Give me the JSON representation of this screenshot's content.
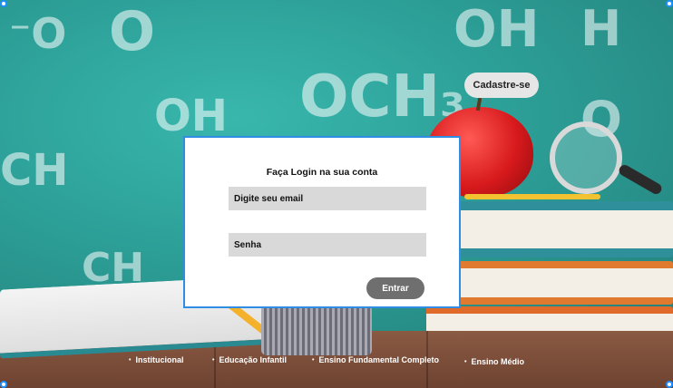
{
  "header": {
    "register_button": "Cadastre-se"
  },
  "login": {
    "title": "Faça Login na sua conta",
    "email_placeholder": "Digite seu email",
    "password_placeholder": "Senha",
    "submit_label": "Entrar"
  },
  "footer_nav": {
    "bullet": "•",
    "items": [
      {
        "label": "Institucional"
      },
      {
        "label": "Educação Infantil"
      },
      {
        "label": "Ensino Fundamental Completo"
      },
      {
        "label": "Ensino Médio"
      }
    ]
  },
  "colors": {
    "accent": "#2f8de4",
    "board": "#2aa39a",
    "button_gray": "#6f6f6f",
    "field_gray": "#d9d9d9"
  }
}
